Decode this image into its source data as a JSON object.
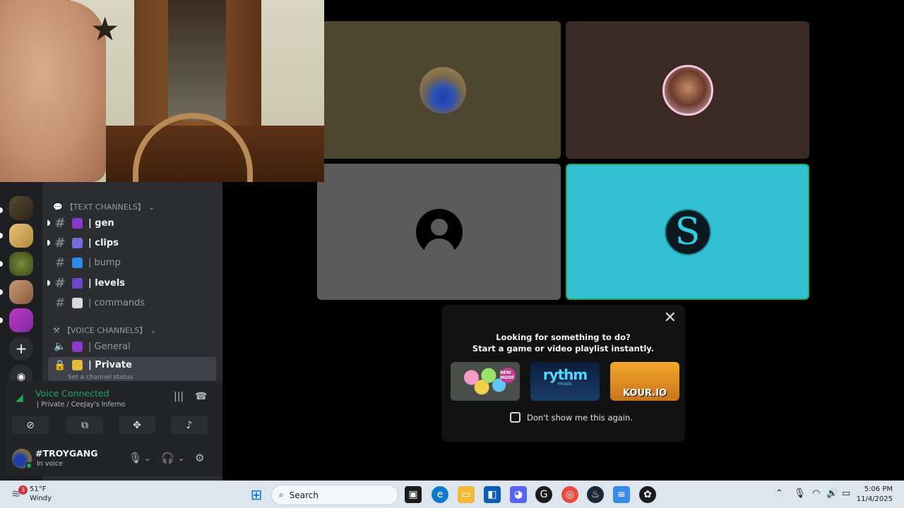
{
  "video": {
    "tiles": [
      "car-avatar",
      "profile-avatar",
      "default-avatar",
      "s-logo-avatar"
    ],
    "s_logo_letter": "S"
  },
  "activity": {
    "title_line1": "Looking for something to do?",
    "title_line2": "Start a game or video playlist instantly.",
    "close": "✕",
    "cards": [
      {
        "label": "",
        "badge": "NEW MODE"
      },
      {
        "label": "rythm",
        "sub": "music"
      },
      {
        "label": "KOUR.IO"
      }
    ],
    "dont_show": "Don't show me this again."
  },
  "sidebar": {
    "text_category": "【TEXT CHANNELS】",
    "voice_category": "【VOICE CHANNELS】",
    "text_channels": [
      {
        "name": "| gen",
        "unread": true
      },
      {
        "name": "| clips",
        "unread": true
      },
      {
        "name": "| bump",
        "unread": false
      },
      {
        "name": "| levels",
        "unread": true
      },
      {
        "name": "| commands",
        "unread": false
      }
    ],
    "voice_channels": [
      {
        "name": "| General"
      },
      {
        "name": "| Private",
        "status": "Set a channel status",
        "active": true
      }
    ]
  },
  "voice": {
    "status": "Voice Connected",
    "location": "| Private / CeeJay's Inferno"
  },
  "user": {
    "name": "#TROYGANG",
    "status": "In voice"
  },
  "taskbar": {
    "weather_temp": "51°F",
    "weather_desc": "Windy",
    "weather_badge": "3",
    "search_placeholder": "Search",
    "time": "5:06 PM",
    "date": "11/4/2025"
  },
  "colors": {
    "voice_green": "#23a55a",
    "speaking_tile": "#33c0d3",
    "sidebar_bg": "#2b2d31"
  }
}
